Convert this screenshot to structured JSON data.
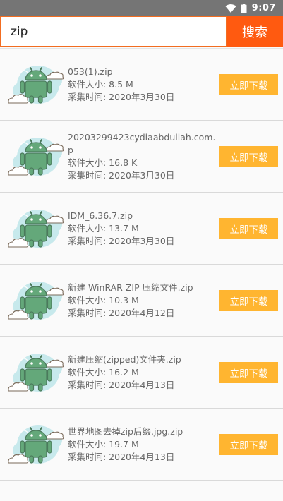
{
  "status_bar": {
    "time": "9:07"
  },
  "search": {
    "query": "zip",
    "button_label": "搜索"
  },
  "files": [
    {
      "name": "053(1).zip",
      "size": "软件大小: 8.5 M",
      "date": "采集时间: 2020年3月30日",
      "button": "立即下载"
    },
    {
      "name": "20203299423cydiaabdullah.com.p",
      "size": "软件大小: 16.8 K",
      "date": "采集时间: 2020年3月30日",
      "button": "立即下载"
    },
    {
      "name": "IDM_6.36.7.zip",
      "size": "软件大小: 13.7 M",
      "date": "采集时间: 2020年3月30日",
      "button": "立即下载"
    },
    {
      "name": "新建 WinRAR ZIP 压缩文件.zip",
      "size": "软件大小: 10.3 M",
      "date": "采集时间: 2020年4月12日",
      "button": "立即下载"
    },
    {
      "name": "新建压缩(zipped)文件夹.zip",
      "size": "软件大小: 16.2 M",
      "date": "采集时间: 2020年4月13日",
      "button": "立即下载"
    },
    {
      "name": "世界地图去掉zip后缀.jpg.zip",
      "size": "软件大小: 19.7 M",
      "date": "采集时间: 2020年4月13日",
      "button": "立即下载"
    }
  ],
  "thumbnail_icon": "android-robot-cloud-icon"
}
